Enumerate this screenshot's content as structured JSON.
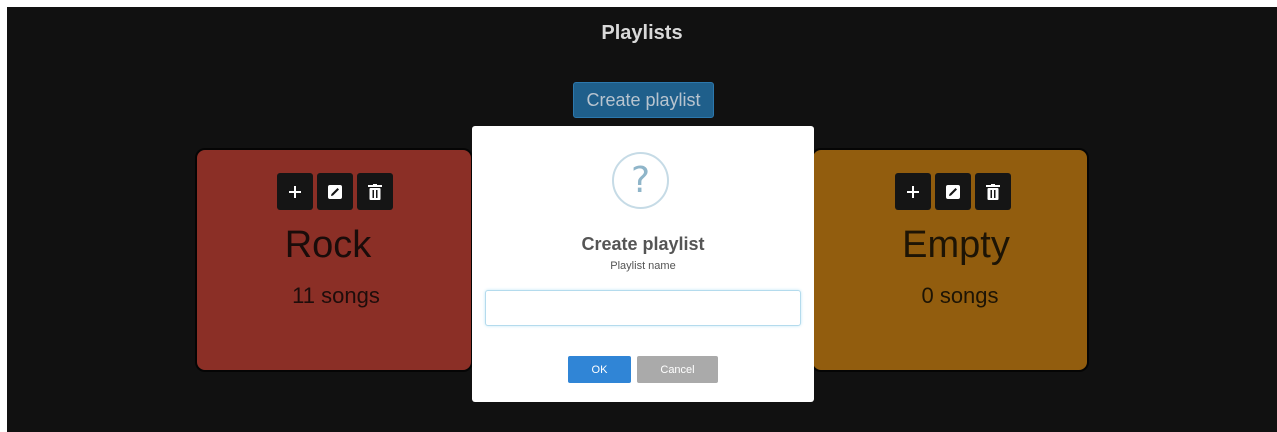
{
  "header": {
    "title": "Playlists",
    "create_button_label": "Create playlist"
  },
  "colors": {
    "background": "#111111",
    "create_button": "#1f5f8b",
    "card_rock": "#8b2f26",
    "card_empty": "#925d0e",
    "ok_button": "#3085d6",
    "cancel_button": "#aaaaaa"
  },
  "playlists": [
    {
      "name": "Rock",
      "count_label": "11 songs",
      "actions": [
        "plus-icon",
        "edit-icon",
        "trash-icon"
      ]
    },
    {
      "name": "Empty",
      "count_label": "0 songs",
      "actions": [
        "plus-icon",
        "edit-icon",
        "trash-icon"
      ]
    }
  ],
  "dialog": {
    "icon_glyph": "?",
    "icon": "question-icon",
    "title": "Create playlist",
    "text": "Playlist name",
    "input_value": "",
    "confirm_label": "OK",
    "cancel_label": "Cancel"
  }
}
